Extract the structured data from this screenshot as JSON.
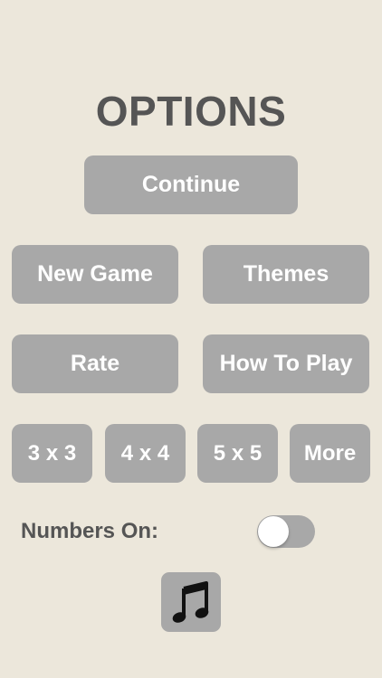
{
  "title": "OPTIONS",
  "buttons": {
    "continue": "Continue",
    "new_game": "New Game",
    "themes": "Themes",
    "rate": "Rate",
    "how_to_play": "How To Play"
  },
  "grid_sizes": {
    "size_3": "3 x 3",
    "size_4": "4 x 4",
    "size_5": "5 x 5",
    "more": "More"
  },
  "numbers_toggle": {
    "label": "Numbers On:",
    "on": false
  },
  "music": {
    "icon": "music-note-icon"
  },
  "colors": {
    "background": "#ece7db",
    "button": "#a8a8a8",
    "button_text": "#ffffff",
    "title_text": "#555555"
  }
}
